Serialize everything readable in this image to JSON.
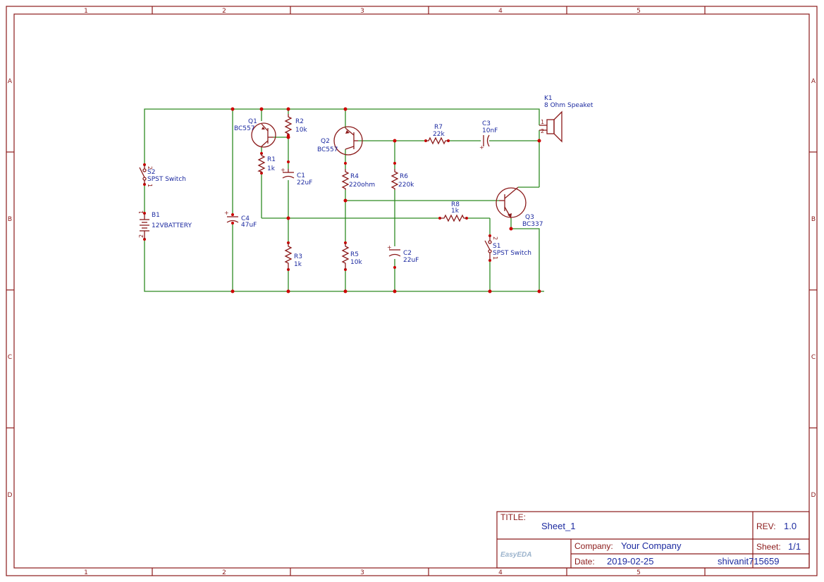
{
  "frame": {
    "col_labels": [
      "1",
      "2",
      "3",
      "4",
      "5"
    ],
    "row_labels": [
      "A",
      "B",
      "C",
      "D"
    ]
  },
  "components": {
    "k1": {
      "ref": "K1",
      "value": "8 Ohm Speaket",
      "pin1": "1",
      "pin2": "2"
    },
    "q1": {
      "ref": "Q1",
      "value": "BC557"
    },
    "q2": {
      "ref": "Q2",
      "value": "BC557"
    },
    "q3": {
      "ref": "Q3",
      "value": "BC337"
    },
    "r1": {
      "ref": "R1",
      "value": "1k"
    },
    "r2": {
      "ref": "R2",
      "value": "10k"
    },
    "r3": {
      "ref": "R3",
      "value": "1k"
    },
    "r4": {
      "ref": "R4",
      "value": "220ohm"
    },
    "r5": {
      "ref": "R5",
      "value": "10k"
    },
    "r6": {
      "ref": "R6",
      "value": "220k"
    },
    "r7": {
      "ref": "R7",
      "value": "22k"
    },
    "r8": {
      "ref": "R8",
      "value": "1k"
    },
    "c1": {
      "ref": "C1",
      "value": "22uF"
    },
    "c2": {
      "ref": "C2",
      "value": "22uF"
    },
    "c3": {
      "ref": "C3",
      "value": "10nF"
    },
    "c4": {
      "ref": "C4",
      "value": "47uF"
    },
    "b1": {
      "ref": "B1",
      "value": "12VBATTERY",
      "pin1": "1",
      "pin2": "2"
    },
    "s1": {
      "ref": "S1",
      "value": "SPST Switch",
      "pin1": "1",
      "pin2": "2"
    },
    "s2": {
      "ref": "S2",
      "value": "SPST Switch",
      "pin1": "1",
      "pin2": "2"
    }
  },
  "title_block": {
    "title_label": "TITLE:",
    "title_value": "Sheet_1",
    "rev_label": "REV:",
    "rev_value": "1.0",
    "company_label": "Company:",
    "company_value": "Your Company",
    "sheet_label": "Sheet:",
    "sheet_value": "1/1",
    "date_label": "Date:",
    "date_value": "2019-02-25",
    "author": "shivanit715659",
    "logo_text": "EasyEDA"
  },
  "colors": {
    "frame": "#8b1a1a",
    "wire": "#2e8b22",
    "label": "#1c2aa0",
    "junction": "#cc0000"
  }
}
